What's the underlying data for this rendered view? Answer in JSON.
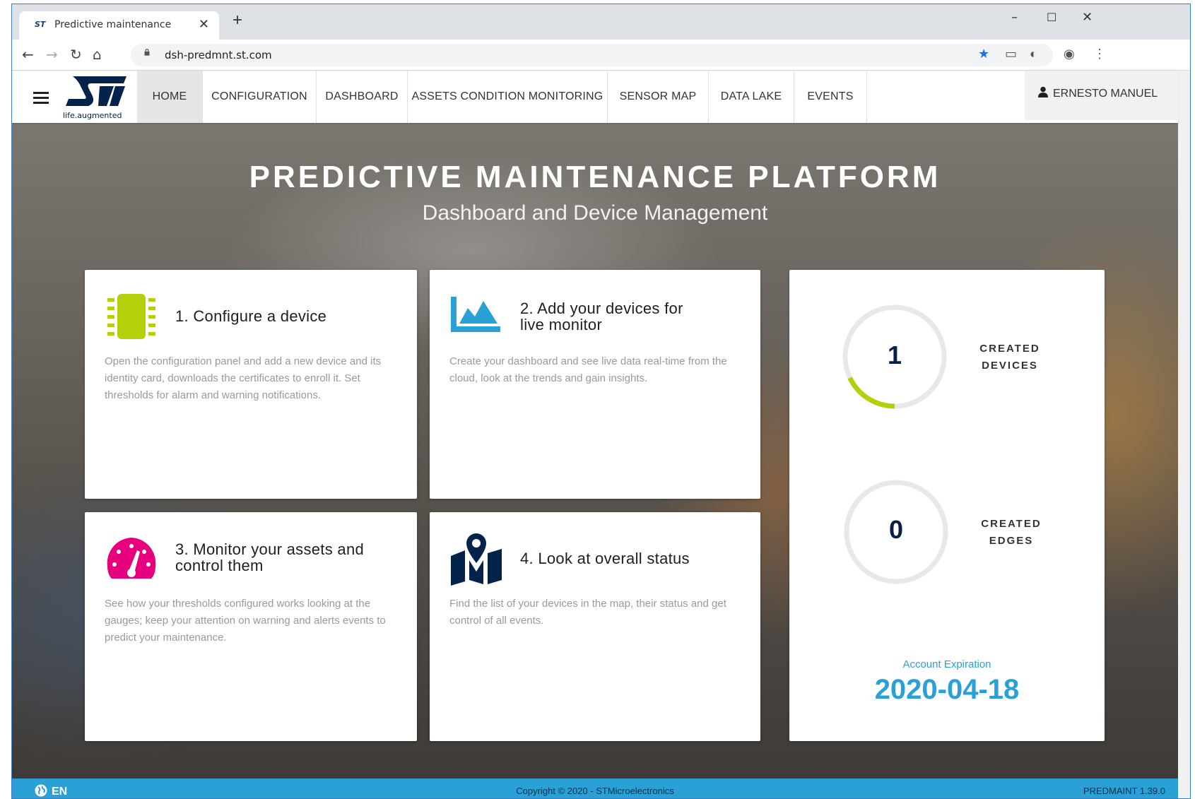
{
  "browser": {
    "tab_title": "Predictive maintenance",
    "new_tab": "+",
    "url": "dsh-predmnt.st.com",
    "controls": {
      "minimize": "–",
      "maximize": "☐",
      "close": "✕"
    }
  },
  "nav": {
    "logo_tagline": "life.augmented",
    "items": [
      {
        "label": "HOME"
      },
      {
        "label": "CONFIGURATION"
      },
      {
        "label": "DASHBOARD"
      },
      {
        "label": "ASSETS CONDITION MONITORING"
      },
      {
        "label": "SENSOR MAP"
      },
      {
        "label": "DATA LAKE"
      },
      {
        "label": "EVENTS"
      }
    ],
    "user": "ERNESTO MANUEL"
  },
  "hero": {
    "title": "PREDICTIVE MAINTENANCE PLATFORM",
    "subtitle": "Dashboard and Device Management"
  },
  "cards": [
    {
      "title_line1": "1. Configure a device",
      "title_line2": "",
      "description": "Open the configuration panel and add a new device and its identity card, downloads the certificates to enroll it. Set thresholds for alarm and warning notifications.",
      "icon": "chip-icon"
    },
    {
      "title_line1": "2. Add your devices for",
      "title_line2": "live monitor",
      "description": "Create your dashboard and see live data real-time from the cloud, look at the trends and gain insights.",
      "icon": "area-chart-icon"
    },
    {
      "title_line1": "3. Monitor your assets and",
      "title_line2": "control them",
      "description": "See how your thresholds configured works looking at the gauges; keep your attention on warning and alerts events to predict your maintenance.",
      "icon": "gauge-icon"
    },
    {
      "title_line1": "4. Look at overall status",
      "title_line2": "",
      "description": "Find the list of your devices in the map, their status and get control of all events.",
      "icon": "map-icon"
    }
  ],
  "stats": {
    "devices": {
      "value": "1",
      "label_line1": "CREATED",
      "label_line2": "DEVICES",
      "ring_fraction": 0.18
    },
    "edges": {
      "value": "0",
      "label_line1": "CREATED",
      "label_line2": "EDGES",
      "ring_fraction": 0
    },
    "expiration_label": "Account Expiration",
    "expiration_date": "2020-04-18"
  },
  "footer": {
    "lang": "EN",
    "copyright": "Copyright © 2020 - STMicroelectronics",
    "version": "PREDMAINT  1.39.0"
  },
  "colors": {
    "accent_blue": "#29a1d6",
    "chip_green": "#b5cf0b",
    "gauge_magenta": "#e6007e",
    "map_navy": "#03234b"
  }
}
